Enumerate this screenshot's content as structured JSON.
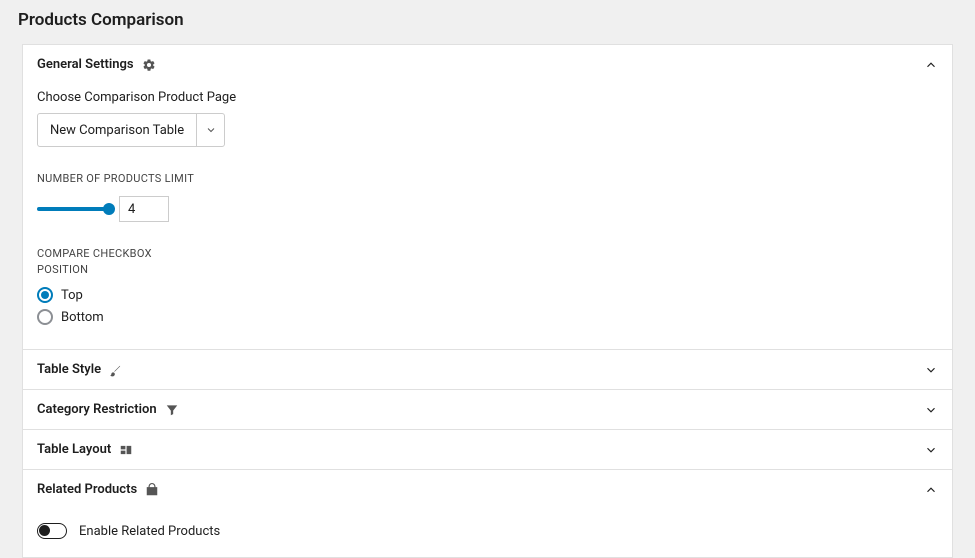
{
  "page": {
    "title": "Products Comparison"
  },
  "general_settings": {
    "title": "General Settings",
    "choose_page_label": "Choose Comparison Product Page",
    "choose_page_value": "New Comparison Table",
    "num_products_label": "Number of Products Limit",
    "num_products_value": "4",
    "checkbox_position_label": "Compare Checkbox Position",
    "radio_top": "Top",
    "radio_bottom": "Bottom"
  },
  "table_style": {
    "title": "Table Style"
  },
  "category_restriction": {
    "title": "Category Restriction"
  },
  "table_layout": {
    "title": "Table Layout"
  },
  "related_products": {
    "title": "Related Products",
    "toggle_label": "Enable Related Products"
  }
}
